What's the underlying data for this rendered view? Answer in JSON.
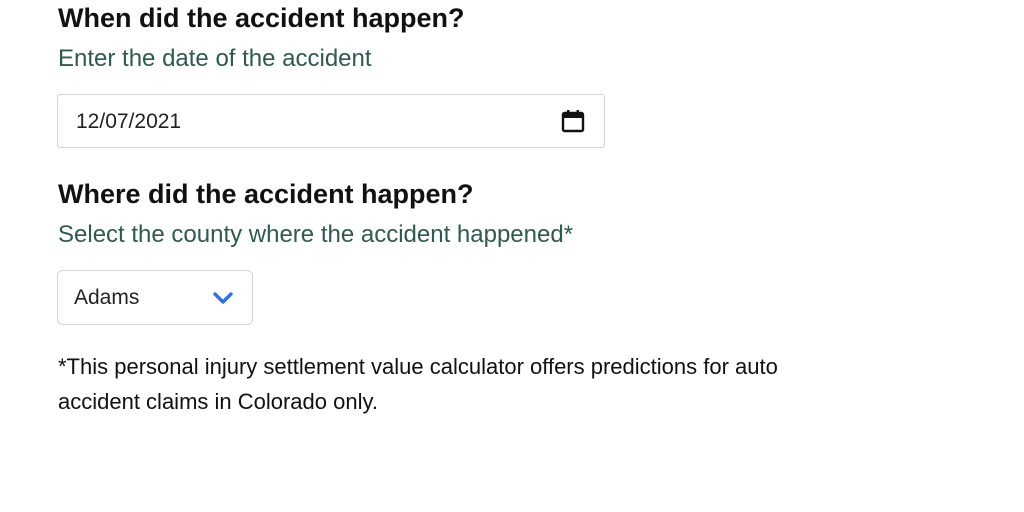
{
  "date_section": {
    "heading": "When did the accident happen?",
    "subheading": "Enter the date of the accident",
    "date_value": "12/07/2021",
    "calendar_icon": "calendar-icon"
  },
  "location_section": {
    "heading": "Where did the accident happen?",
    "subheading": "Select the county where the accident happened*",
    "county_value": "Adams",
    "dropdown_icon": "chevron-down-icon",
    "dropdown_icon_color": "#2f6fe0"
  },
  "footnote": {
    "line1": "*This personal injury settlement value calculator offers predictions for auto",
    "line2": "accident claims in Colorado only."
  },
  "colors": {
    "heading": "#111111",
    "subheading": "#2f5a4f",
    "input_border": "#d4d4d4"
  }
}
